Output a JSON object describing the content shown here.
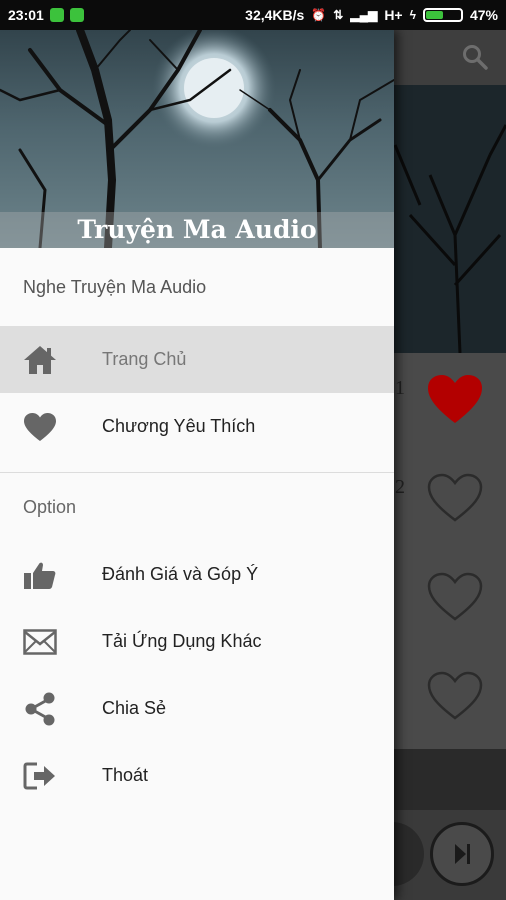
{
  "status_bar": {
    "time": "23:01",
    "network_speed": "32,4KB/s",
    "network_type": "H+",
    "battery": "47%",
    "battery_level": 0.47
  },
  "drawer": {
    "header_title": "Truyện Ma Audio",
    "subheader": "Nghe Truyện Ma Audio",
    "main_items": [
      {
        "label": "Trang Chủ",
        "icon": "home-icon",
        "selected": true
      },
      {
        "label": "Chương Yêu Thích",
        "icon": "heart-icon",
        "selected": false
      }
    ],
    "section_label": "Option",
    "option_items": [
      {
        "label": "Đánh Giá và Góp Ý",
        "icon": "thumbs-up-icon"
      },
      {
        "label": "Tải Ứng Dụng Khác",
        "icon": "mail-icon"
      },
      {
        "label": "Chia Sẻ",
        "icon": "share-icon"
      },
      {
        "label": "Thoát",
        "icon": "exit-icon"
      }
    ]
  },
  "background": {
    "list_numbers": [
      "1",
      "2"
    ],
    "accent_red": "#b30000"
  }
}
